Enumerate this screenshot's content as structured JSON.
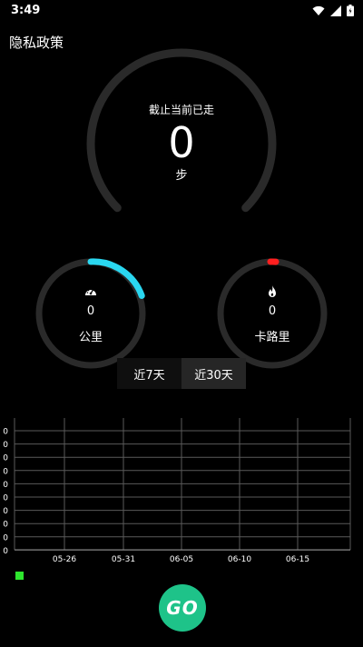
{
  "status_bar": {
    "time": "3:49"
  },
  "header": {
    "privacy_label": "隐私政策"
  },
  "steps": {
    "caption": "截止当前已走",
    "value": "0",
    "unit": "步"
  },
  "distance": {
    "value": "0",
    "unit": "公里",
    "icon": "speedometer-icon",
    "color": "#2ad7f0"
  },
  "calories": {
    "value": "0",
    "unit": "卡路里",
    "icon": "flame-icon",
    "color": "#ff1f1f"
  },
  "range_tabs": [
    {
      "label": "近7天",
      "selected": false
    },
    {
      "label": "近30天",
      "selected": true
    }
  ],
  "chart_data": {
    "type": "line",
    "x_ticks": [
      "05-26",
      "05-31",
      "06-05",
      "06-10",
      "06-15"
    ],
    "y_ticks": [
      "0",
      "0",
      "0",
      "0",
      "0",
      "0",
      "0",
      "0",
      "0",
      "0"
    ],
    "series": [
      {
        "values": [],
        "color": "#2ee62e"
      }
    ],
    "grid": true
  },
  "go_button": {
    "label": "GO"
  },
  "colors": {
    "track": "#2a2a2a",
    "go": "#1ec389",
    "legend": "#2ee62e"
  }
}
